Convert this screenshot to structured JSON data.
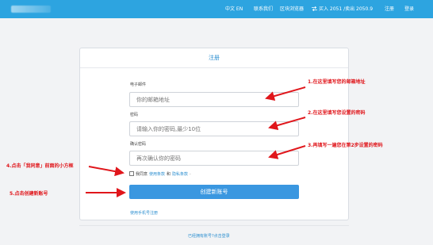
{
  "header": {
    "lang": "中文 EN",
    "contact": "联系我们",
    "browser": "区块浏览器",
    "rate": "买入 2051 /卖出 2050.9",
    "register": "注册",
    "login": "登录"
  },
  "form": {
    "title": "注册",
    "email_label": "电子邮件",
    "email_placeholder": "你的邮箱地址",
    "password_label": "密码",
    "password_placeholder": "请输入你的密码,最少10位",
    "confirm_label": "确认密码",
    "confirm_placeholder": "再次确认你的密码",
    "agree_prefix": "我同意",
    "terms_link": "使用条款",
    "and_text": "和",
    "privacy_link": "隐私条款",
    "period": ".",
    "create_button": "创建新账号",
    "phone_register": "使用手机号注册",
    "have_account": "已经拥有账号?点击登录"
  },
  "annotations": {
    "step1": "1.在这里填写您的邮箱地址",
    "step2": "2.在这里填写您设置的密码",
    "step3": "3.再填写一遍您在第2步设置的密码",
    "step4": "4.点击「我同意」前面的小方框",
    "step5": "5.点击创建新账号"
  },
  "colors": {
    "topbar": "#2da4e0",
    "button": "#3a97e0",
    "link": "#2d8fd0",
    "annotation": "#e0161b"
  },
  "icons": {
    "rate": "exchange-arrows-icon",
    "arrow": "red-arrow-icon"
  }
}
